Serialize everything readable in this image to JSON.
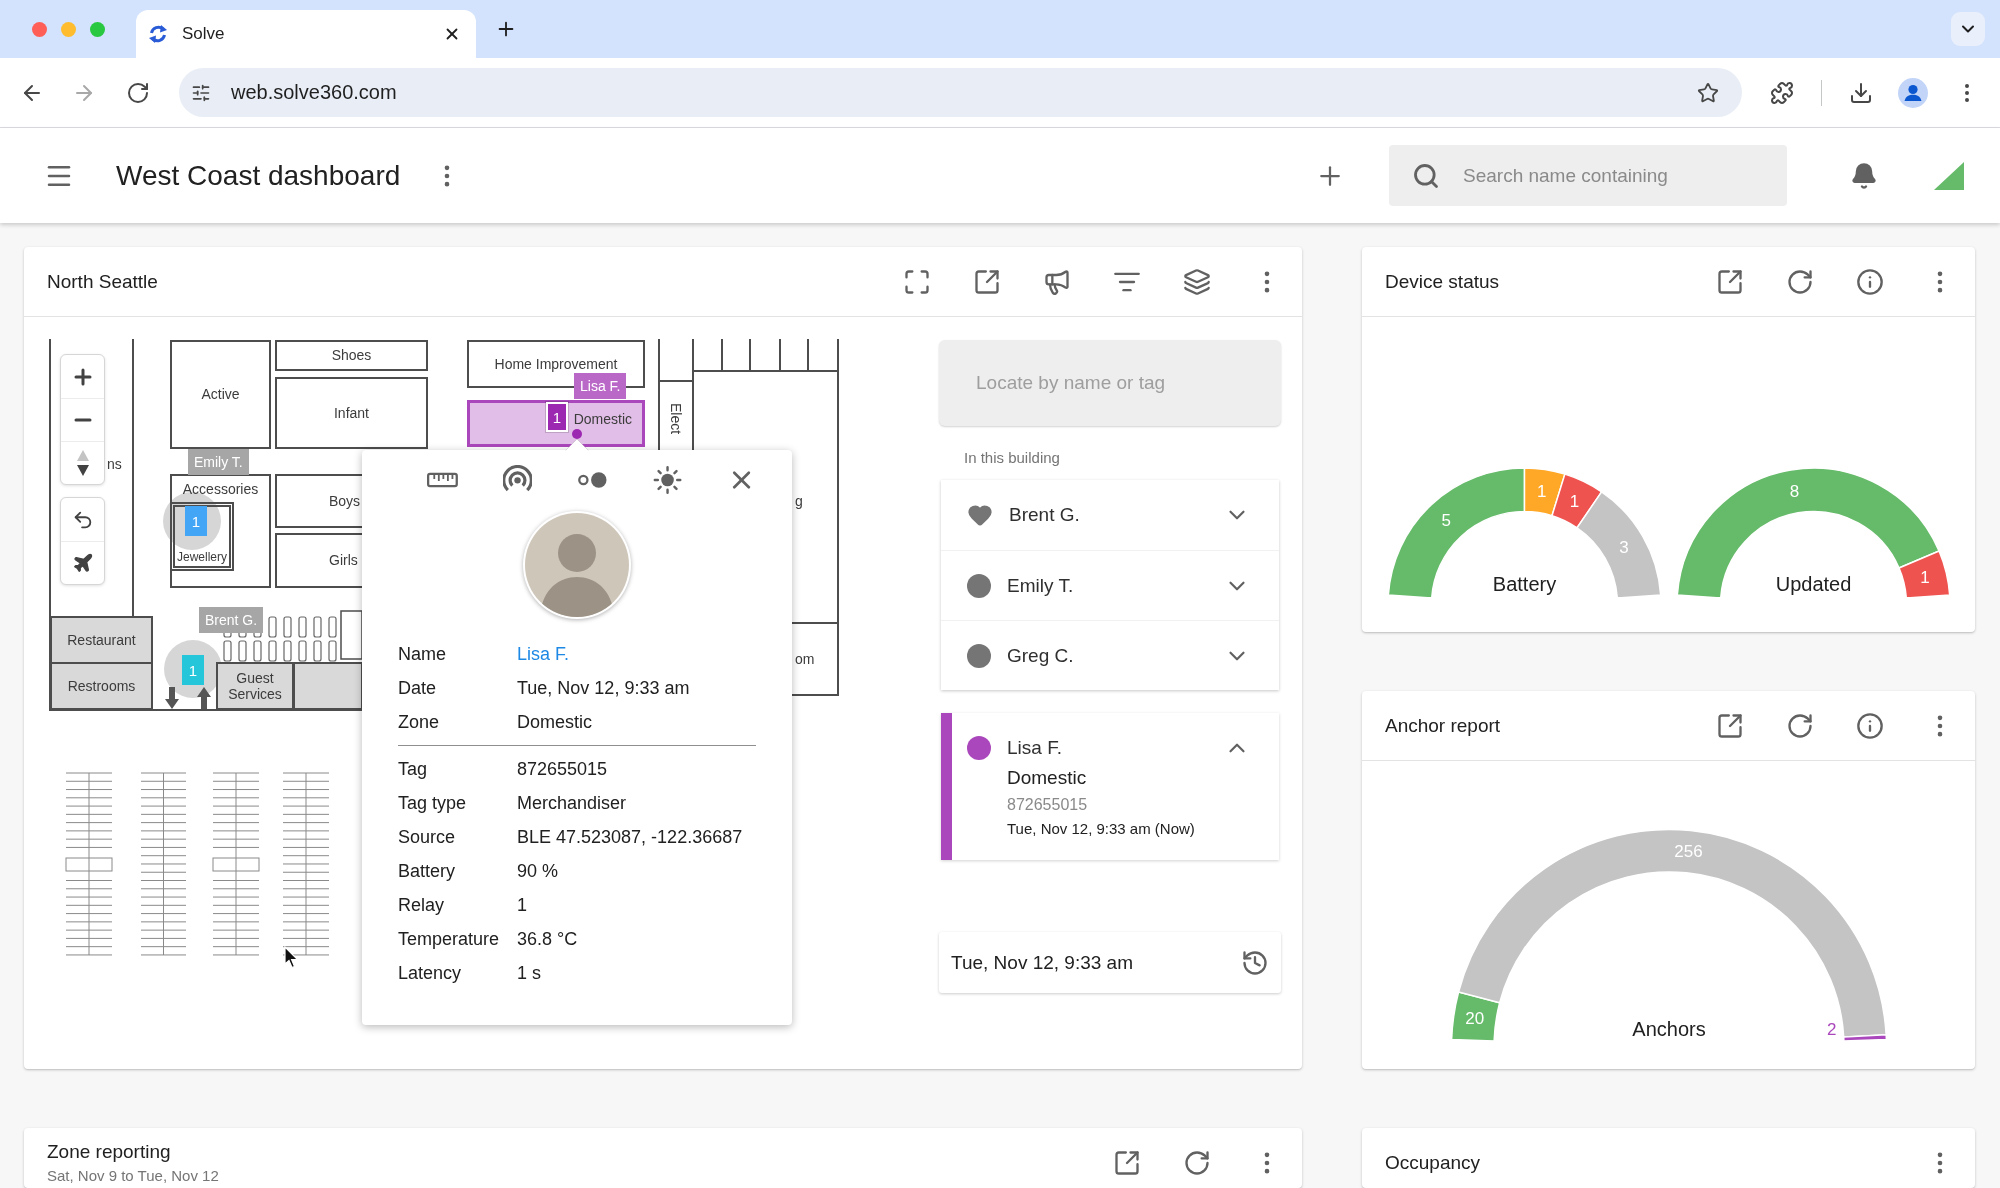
{
  "browser": {
    "tabs": [
      {
        "title": "Solve",
        "selected": true
      }
    ],
    "url": "web.solve360.com"
  },
  "app_bar": {
    "title": "West Coast dashboard",
    "search": {
      "placeholder": "Search name containing"
    }
  },
  "map_card": {
    "title": "North Seattle",
    "map": {
      "rooms": [
        {
          "label": "Shoes",
          "selected": false
        },
        {
          "label": "Home Improvement",
          "selected": false
        },
        {
          "label": "Active",
          "selected": false
        },
        {
          "label": "Infant",
          "selected": false
        },
        {
          "label": "Domestic",
          "selected": true
        },
        {
          "label": "Accessories",
          "selected": false
        },
        {
          "label": "Boys",
          "selected": false
        },
        {
          "label": "Jewellery",
          "selected": false
        },
        {
          "label": "Girls",
          "selected": false
        },
        {
          "label": "Restaurant",
          "selected": false
        },
        {
          "label": "Restrooms",
          "selected": false
        },
        {
          "label": "Guest Services",
          "selected": false
        }
      ],
      "partial_labels": [
        "ns",
        "Elect",
        "g",
        "om"
      ],
      "tags": [
        {
          "name": "Lisa F.",
          "color": "#ba68c8"
        },
        {
          "name": "Emily T.",
          "color": "#a6a6a6"
        },
        {
          "name": "Brent G.",
          "color": "#a6a6a6"
        }
      ],
      "markers": [
        {
          "count": "1",
          "color": "#9c27b0",
          "selected": true
        },
        {
          "count": "1",
          "color": "#42a5f5",
          "selected": false
        },
        {
          "count": "1",
          "color": "#26c6da",
          "selected": false
        }
      ]
    },
    "popup": {
      "sections": [
        {
          "rows": [
            {
              "label": "Name",
              "value": "Lisa F.",
              "kind": "link"
            },
            {
              "label": "Date",
              "value": "Tue, Nov 12, 9:33 am",
              "kind": "text"
            },
            {
              "label": "Zone",
              "value": "Domestic",
              "kind": "text"
            }
          ]
        },
        {
          "rows": [
            {
              "label": "Tag",
              "value": "872655015",
              "kind": "text"
            },
            {
              "label": "Tag type",
              "value": "Merchandiser",
              "kind": "text"
            },
            {
              "label": "Source",
              "value": "BLE 47.523087, -122.36687",
              "kind": "text"
            },
            {
              "label": "Battery",
              "value": "90 %",
              "kind": "text"
            },
            {
              "label": "Relay",
              "value": "1",
              "kind": "text"
            },
            {
              "label": "Temperature",
              "value": "36.8 °C",
              "kind": "text"
            },
            {
              "label": "Latency",
              "value": "1 s",
              "kind": "text"
            }
          ]
        }
      ]
    },
    "locate": {
      "placeholder": "Locate by name or tag"
    },
    "list_heading": "In this building",
    "people": [
      {
        "name": "Brent G.",
        "kind": "heart",
        "color": "#757575",
        "expanded": false
      },
      {
        "name": "Emily T.",
        "kind": "dot",
        "color": "#757575",
        "expanded": false
      },
      {
        "name": "Greg C.",
        "kind": "dot",
        "color": "#757575",
        "expanded": false
      }
    ],
    "selected_person": {
      "name": "Lisa F.",
      "kind": "dot",
      "color": "#ab47bc",
      "expanded": true,
      "zone": "Domestic",
      "tag": "872655015",
      "time": "Tue, Nov 12, 9:33 am (Now)"
    },
    "time_field": {
      "value": "Tue, Nov 12, 9:33 am"
    }
  },
  "device_status": {
    "title": "Device status",
    "gauges": [
      {
        "chart_data": {
          "type": "donut",
          "title": "Battery",
          "values": [
            5,
            1,
            1,
            3
          ],
          "colors": [
            "#66bb6a",
            "#ffa726",
            "#ef5350",
            "#c4c4c4"
          ],
          "data_labels": true
        }
      },
      {
        "chart_data": {
          "type": "donut",
          "title": "Updated",
          "values": [
            8,
            1
          ],
          "colors": [
            "#66bb6a",
            "#ef5350"
          ],
          "data_labels": true
        }
      }
    ]
  },
  "anchor_report": {
    "title": "Anchor report",
    "chart_data": {
      "type": "donut",
      "title": "Anchors",
      "values": [
        20,
        256,
        2
      ],
      "colors": [
        "#66bb6a",
        "#c4c4c4",
        "#ab47bc"
      ],
      "data_labels": true
    }
  },
  "zone_reporting": {
    "title": "Zone reporting",
    "subtitle": "Sat, Nov 9 to Tue, Nov 12"
  },
  "occupancy": {
    "title": "Occupancy"
  }
}
